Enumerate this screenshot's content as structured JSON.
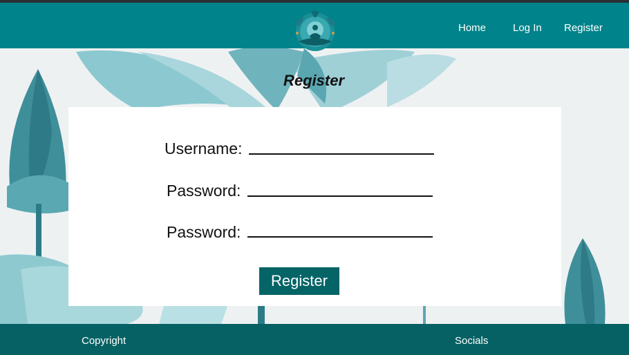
{
  "header": {
    "nav": [
      {
        "label": "Home"
      },
      {
        "label": "Log In"
      },
      {
        "label": "Register"
      }
    ]
  },
  "page": {
    "title": "Register"
  },
  "form": {
    "username_label": "Username:",
    "password_label": "Password:",
    "confirm_password_label": "Password:",
    "username_value": "",
    "password_value": "",
    "confirm_password_value": "",
    "submit_label": "Register"
  },
  "footer": {
    "copyright": "Copyright",
    "socials": "Socials"
  },
  "colors": {
    "header_bg": "#00838a",
    "footer_bg": "#056164",
    "button_bg": "#046466",
    "lotus": "#3f9aa3"
  },
  "icons": {
    "logo": "lotus-meditation-logo"
  }
}
